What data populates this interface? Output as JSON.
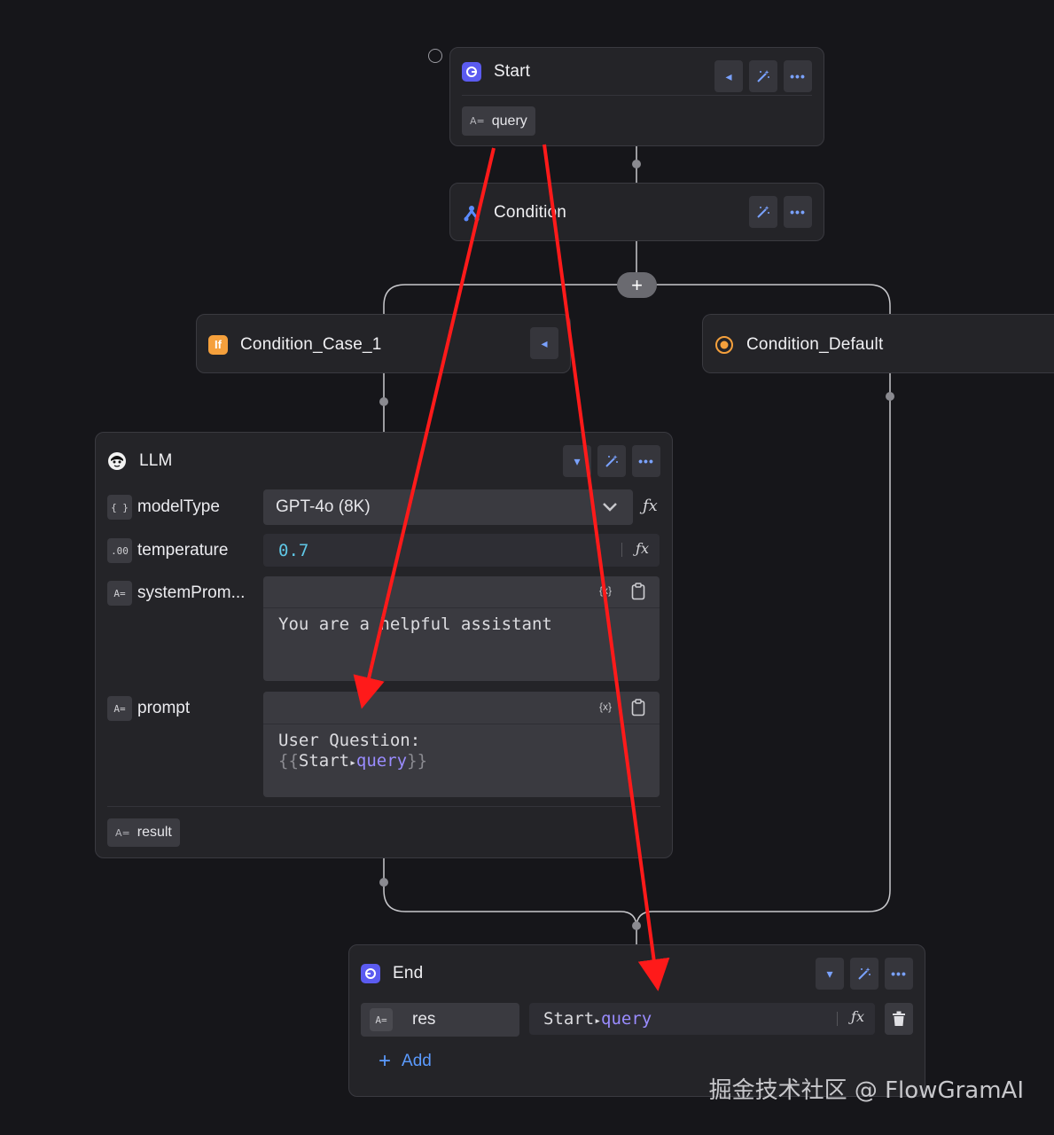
{
  "nodes": {
    "start": {
      "title": "Start",
      "output": "query"
    },
    "condition": {
      "title": "Condition"
    },
    "case1": {
      "title": "Condition_Case_1",
      "icon_text": "If"
    },
    "default": {
      "title": "Condition_Default"
    },
    "llm": {
      "title": "LLM",
      "params": {
        "modelType": {
          "label": "modelType",
          "badge": "{ }",
          "value": "GPT-4o (8K)"
        },
        "temperature": {
          "label": "temperature",
          "badge": ".00",
          "value": "0.7"
        },
        "systemPrompt": {
          "label": "systemProm...",
          "badge": "A=",
          "value": "You are a helpful assistant"
        },
        "prompt": {
          "label": "prompt",
          "badge": "A=",
          "line1": "User Question:",
          "ref_open": "{{",
          "ref_node": "Start",
          "ref_sep": "▸",
          "ref_var": "query",
          "ref_close": "}}",
          "var_icon": "{x}"
        }
      },
      "output": "result"
    },
    "end": {
      "title": "End",
      "row": {
        "name": "res",
        "ref_node": "Start",
        "ref_sep": "▸",
        "ref_var": "query"
      },
      "add_label": "Add"
    }
  },
  "icons": {
    "fx": "ƒx",
    "collapse": "◂",
    "expand": "▾",
    "wand": "wand-icon",
    "more": "•••",
    "plus": "+",
    "trash": "trash-icon",
    "clipboard": "clipboard-icon",
    "chevron": "chevron-down-icon"
  },
  "colors": {
    "background": "#16161a",
    "node": "#242428",
    "accent": "#7aa2ff",
    "arrow": "#ff1a1a",
    "case_icon": "#f5a03c",
    "default_icon": "#f5a03c",
    "start_icon": "#5b5bf0",
    "variable": "#9a8cff",
    "number": "#5fc7e6"
  },
  "watermark": "掘金技术社区 @ FlowGramAI"
}
